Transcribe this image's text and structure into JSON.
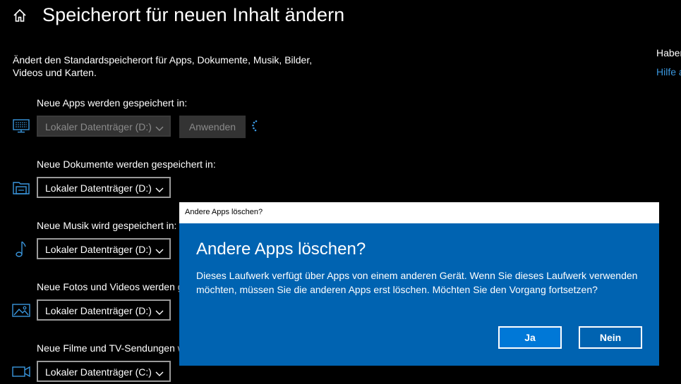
{
  "header": {
    "title": "Speicherort für neuen Inhalt ändern",
    "description": "Ändert den Standardspeicherort für Apps, Dokumente, Musik, Bilder, Videos und Karten."
  },
  "side_panel": {
    "question": "Haben",
    "help_link": "Hilfe a"
  },
  "sections": [
    {
      "label": "Neue Apps werden gespeichert in:",
      "value": "Lokaler Datenträger (D:)",
      "icon": "monitor-icon",
      "disabled": true
    },
    {
      "label": "Neue Dokumente werden gespeichert in:",
      "value": "Lokaler Datenträger (D:)",
      "icon": "folder-icon"
    },
    {
      "label": "Neue Musik wird gespeichert in:",
      "value": "Lokaler Datenträger (D:)",
      "icon": "music-note-icon"
    },
    {
      "label": "Neue Fotos und Videos werden g",
      "value": "Lokaler Datenträger (D:)",
      "icon": "photo-icon"
    },
    {
      "label": "Neue Filme und TV-Sendungen w",
      "value": "Lokaler Datenträger (C:)",
      "icon": "video-camera-icon"
    }
  ],
  "apply_button": {
    "label": "Anwenden"
  },
  "dialog": {
    "window_title": "Andere Apps löschen?",
    "heading": "Andere Apps löschen?",
    "body": "Dieses Laufwerk verfügt über Apps von einem anderen Gerät. Wenn Sie dieses Laufwerk verwenden möchten, müssen Sie die anderen Apps erst löschen. Möchten Sie den Vorgang fortsetzen?",
    "yes_label": "Ja",
    "no_label": "Nein"
  },
  "colors": {
    "background": "#000000",
    "accent": "#0078d7",
    "dialog_background": "#0063b1",
    "icon_blue": "#3a96dd",
    "link": "#3a96dd"
  }
}
